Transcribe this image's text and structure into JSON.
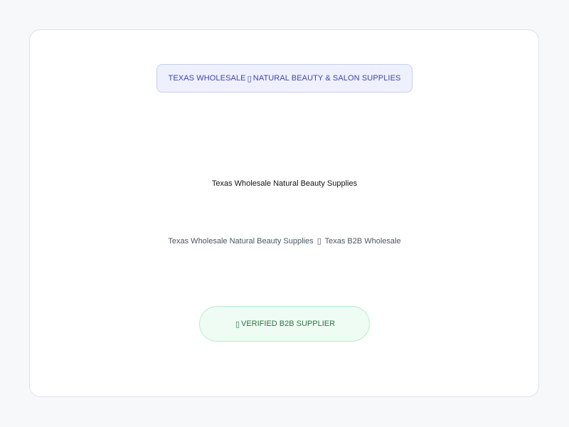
{
  "banner": {
    "left_text": "TEXAS WHOLESALE",
    "separator": "▯",
    "right_text": "NATURAL BEAUTY & SALON SUPPLIES"
  },
  "title": "Texas Wholesale Natural Beauty Supplies",
  "subtitle": {
    "left_text": "Texas Wholesale Natural Beauty Supplies",
    "separator": "▯",
    "right_text": "Texas B2B Wholesale"
  },
  "badge": {
    "glyph": "▯",
    "label": "VERIFIED B2B SUPPLIER"
  },
  "colors": {
    "page_bg": "#f7f8fa",
    "card_bg": "#ffffff",
    "banner_bg": "#eef0fd",
    "banner_text": "#3f47a6",
    "badge_bg": "#effcf3",
    "badge_text": "#1f7a43"
  }
}
